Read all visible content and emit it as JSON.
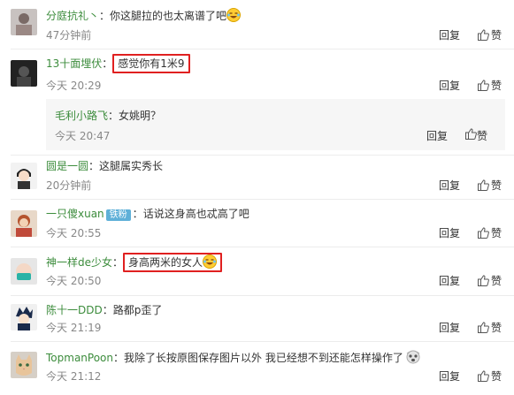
{
  "comments": [
    {
      "user": "分庭抗礼丶",
      "sep": "：",
      "text": "你这腿拉的也太离谱了吧",
      "emoji": "laugh-cry",
      "time": "47分钟前",
      "reply": "回复",
      "like": "赞"
    },
    {
      "user": "13十面埋伏",
      "sep": "：",
      "text": "感觉你有1米9",
      "time": "今天 20:29",
      "reply": "回复",
      "like": "赞"
    },
    {
      "user": "毛利小路飞",
      "sep": "：",
      "text": "女姚明？",
      "time": "今天 20:47",
      "reply": "回复",
      "like": "赞"
    },
    {
      "user": "圆是一圆",
      "sep": "：",
      "text": "这腿属实秀长",
      "time": "20分钟前",
      "reply": "回复",
      "like": "赞"
    },
    {
      "user": "一只傻xuan",
      "badge": "铁粉",
      "sep": "：",
      "text": "话说这身高也忒高了吧",
      "time": "今天 20:55",
      "reply": "回复",
      "like": "赞"
    },
    {
      "user": "神一样de少女",
      "sep": "：",
      "text": "身高两米的女人",
      "emoji": "laugh-cry",
      "time": "今天 20:50",
      "reply": "回复",
      "like": "赞"
    },
    {
      "user": "陈十一DDD",
      "sep": "：",
      "text": "路都p歪了",
      "time": "今天 21:19",
      "reply": "回复",
      "like": "赞"
    },
    {
      "user": "TopmanPoon",
      "sep": "：",
      "text": "我除了长按原图保存图片以外 我已经想不到还能怎样操作了",
      "emoji": "shocked-face",
      "time": "今天 21:12",
      "reply": "回复",
      "like": "赞"
    }
  ],
  "colors": {
    "username": "#3c8c3c",
    "highlight": "#e02020",
    "reply_bg": "#f6f6f6",
    "badge": "#5fb0d8"
  }
}
